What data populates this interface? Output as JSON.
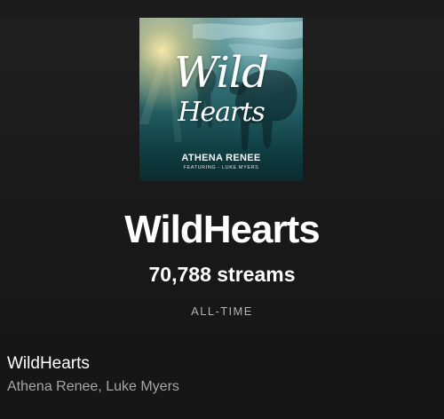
{
  "album_art": {
    "title_line_1": "Wild",
    "title_line_2": "Hearts",
    "artist": "ATHENA RENEE",
    "featuring": "FEATURING - LUKE MYERS"
  },
  "track": {
    "title": "WildHearts",
    "streams": "70,788 streams",
    "period": "ALL-TIME"
  },
  "track_row": {
    "title": "WildHearts",
    "artists": "Athena Renee, Luke Myers"
  },
  "colors": {
    "background": "#121212",
    "primary_text": "#ffffff",
    "secondary_text": "#b3b3b3"
  }
}
